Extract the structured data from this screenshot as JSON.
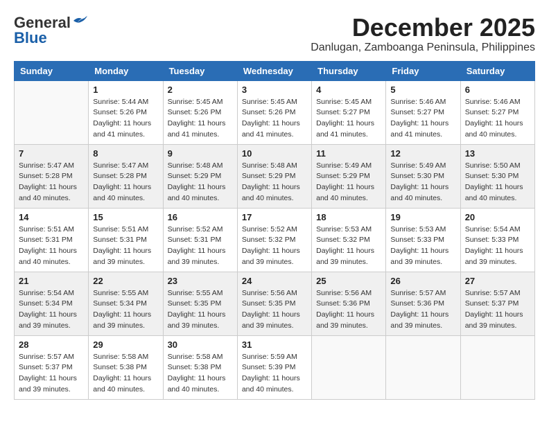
{
  "logo": {
    "general": "General",
    "blue": "Blue"
  },
  "title": "December 2025",
  "location": "Danlugan, Zamboanga Peninsula, Philippines",
  "days_of_week": [
    "Sunday",
    "Monday",
    "Tuesday",
    "Wednesday",
    "Thursday",
    "Friday",
    "Saturday"
  ],
  "weeks": [
    [
      {
        "day": "",
        "sunrise": "",
        "sunset": "",
        "daylight": ""
      },
      {
        "day": "1",
        "sunrise": "Sunrise: 5:44 AM",
        "sunset": "Sunset: 5:26 PM",
        "daylight": "Daylight: 11 hours and 41 minutes."
      },
      {
        "day": "2",
        "sunrise": "Sunrise: 5:45 AM",
        "sunset": "Sunset: 5:26 PM",
        "daylight": "Daylight: 11 hours and 41 minutes."
      },
      {
        "day": "3",
        "sunrise": "Sunrise: 5:45 AM",
        "sunset": "Sunset: 5:26 PM",
        "daylight": "Daylight: 11 hours and 41 minutes."
      },
      {
        "day": "4",
        "sunrise": "Sunrise: 5:45 AM",
        "sunset": "Sunset: 5:27 PM",
        "daylight": "Daylight: 11 hours and 41 minutes."
      },
      {
        "day": "5",
        "sunrise": "Sunrise: 5:46 AM",
        "sunset": "Sunset: 5:27 PM",
        "daylight": "Daylight: 11 hours and 41 minutes."
      },
      {
        "day": "6",
        "sunrise": "Sunrise: 5:46 AM",
        "sunset": "Sunset: 5:27 PM",
        "daylight": "Daylight: 11 hours and 40 minutes."
      }
    ],
    [
      {
        "day": "7",
        "sunrise": "Sunrise: 5:47 AM",
        "sunset": "Sunset: 5:28 PM",
        "daylight": "Daylight: 11 hours and 40 minutes."
      },
      {
        "day": "8",
        "sunrise": "Sunrise: 5:47 AM",
        "sunset": "Sunset: 5:28 PM",
        "daylight": "Daylight: 11 hours and 40 minutes."
      },
      {
        "day": "9",
        "sunrise": "Sunrise: 5:48 AM",
        "sunset": "Sunset: 5:29 PM",
        "daylight": "Daylight: 11 hours and 40 minutes."
      },
      {
        "day": "10",
        "sunrise": "Sunrise: 5:48 AM",
        "sunset": "Sunset: 5:29 PM",
        "daylight": "Daylight: 11 hours and 40 minutes."
      },
      {
        "day": "11",
        "sunrise": "Sunrise: 5:49 AM",
        "sunset": "Sunset: 5:29 PM",
        "daylight": "Daylight: 11 hours and 40 minutes."
      },
      {
        "day": "12",
        "sunrise": "Sunrise: 5:49 AM",
        "sunset": "Sunset: 5:30 PM",
        "daylight": "Daylight: 11 hours and 40 minutes."
      },
      {
        "day": "13",
        "sunrise": "Sunrise: 5:50 AM",
        "sunset": "Sunset: 5:30 PM",
        "daylight": "Daylight: 11 hours and 40 minutes."
      }
    ],
    [
      {
        "day": "14",
        "sunrise": "Sunrise: 5:51 AM",
        "sunset": "Sunset: 5:31 PM",
        "daylight": "Daylight: 11 hours and 40 minutes."
      },
      {
        "day": "15",
        "sunrise": "Sunrise: 5:51 AM",
        "sunset": "Sunset: 5:31 PM",
        "daylight": "Daylight: 11 hours and 39 minutes."
      },
      {
        "day": "16",
        "sunrise": "Sunrise: 5:52 AM",
        "sunset": "Sunset: 5:31 PM",
        "daylight": "Daylight: 11 hours and 39 minutes."
      },
      {
        "day": "17",
        "sunrise": "Sunrise: 5:52 AM",
        "sunset": "Sunset: 5:32 PM",
        "daylight": "Daylight: 11 hours and 39 minutes."
      },
      {
        "day": "18",
        "sunrise": "Sunrise: 5:53 AM",
        "sunset": "Sunset: 5:32 PM",
        "daylight": "Daylight: 11 hours and 39 minutes."
      },
      {
        "day": "19",
        "sunrise": "Sunrise: 5:53 AM",
        "sunset": "Sunset: 5:33 PM",
        "daylight": "Daylight: 11 hours and 39 minutes."
      },
      {
        "day": "20",
        "sunrise": "Sunrise: 5:54 AM",
        "sunset": "Sunset: 5:33 PM",
        "daylight": "Daylight: 11 hours and 39 minutes."
      }
    ],
    [
      {
        "day": "21",
        "sunrise": "Sunrise: 5:54 AM",
        "sunset": "Sunset: 5:34 PM",
        "daylight": "Daylight: 11 hours and 39 minutes."
      },
      {
        "day": "22",
        "sunrise": "Sunrise: 5:55 AM",
        "sunset": "Sunset: 5:34 PM",
        "daylight": "Daylight: 11 hours and 39 minutes."
      },
      {
        "day": "23",
        "sunrise": "Sunrise: 5:55 AM",
        "sunset": "Sunset: 5:35 PM",
        "daylight": "Daylight: 11 hours and 39 minutes."
      },
      {
        "day": "24",
        "sunrise": "Sunrise: 5:56 AM",
        "sunset": "Sunset: 5:35 PM",
        "daylight": "Daylight: 11 hours and 39 minutes."
      },
      {
        "day": "25",
        "sunrise": "Sunrise: 5:56 AM",
        "sunset": "Sunset: 5:36 PM",
        "daylight": "Daylight: 11 hours and 39 minutes."
      },
      {
        "day": "26",
        "sunrise": "Sunrise: 5:57 AM",
        "sunset": "Sunset: 5:36 PM",
        "daylight": "Daylight: 11 hours and 39 minutes."
      },
      {
        "day": "27",
        "sunrise": "Sunrise: 5:57 AM",
        "sunset": "Sunset: 5:37 PM",
        "daylight": "Daylight: 11 hours and 39 minutes."
      }
    ],
    [
      {
        "day": "28",
        "sunrise": "Sunrise: 5:57 AM",
        "sunset": "Sunset: 5:37 PM",
        "daylight": "Daylight: 11 hours and 39 minutes."
      },
      {
        "day": "29",
        "sunrise": "Sunrise: 5:58 AM",
        "sunset": "Sunset: 5:38 PM",
        "daylight": "Daylight: 11 hours and 40 minutes."
      },
      {
        "day": "30",
        "sunrise": "Sunrise: 5:58 AM",
        "sunset": "Sunset: 5:38 PM",
        "daylight": "Daylight: 11 hours and 40 minutes."
      },
      {
        "day": "31",
        "sunrise": "Sunrise: 5:59 AM",
        "sunset": "Sunset: 5:39 PM",
        "daylight": "Daylight: 11 hours and 40 minutes."
      },
      {
        "day": "",
        "sunrise": "",
        "sunset": "",
        "daylight": ""
      },
      {
        "day": "",
        "sunrise": "",
        "sunset": "",
        "daylight": ""
      },
      {
        "day": "",
        "sunrise": "",
        "sunset": "",
        "daylight": ""
      }
    ]
  ]
}
